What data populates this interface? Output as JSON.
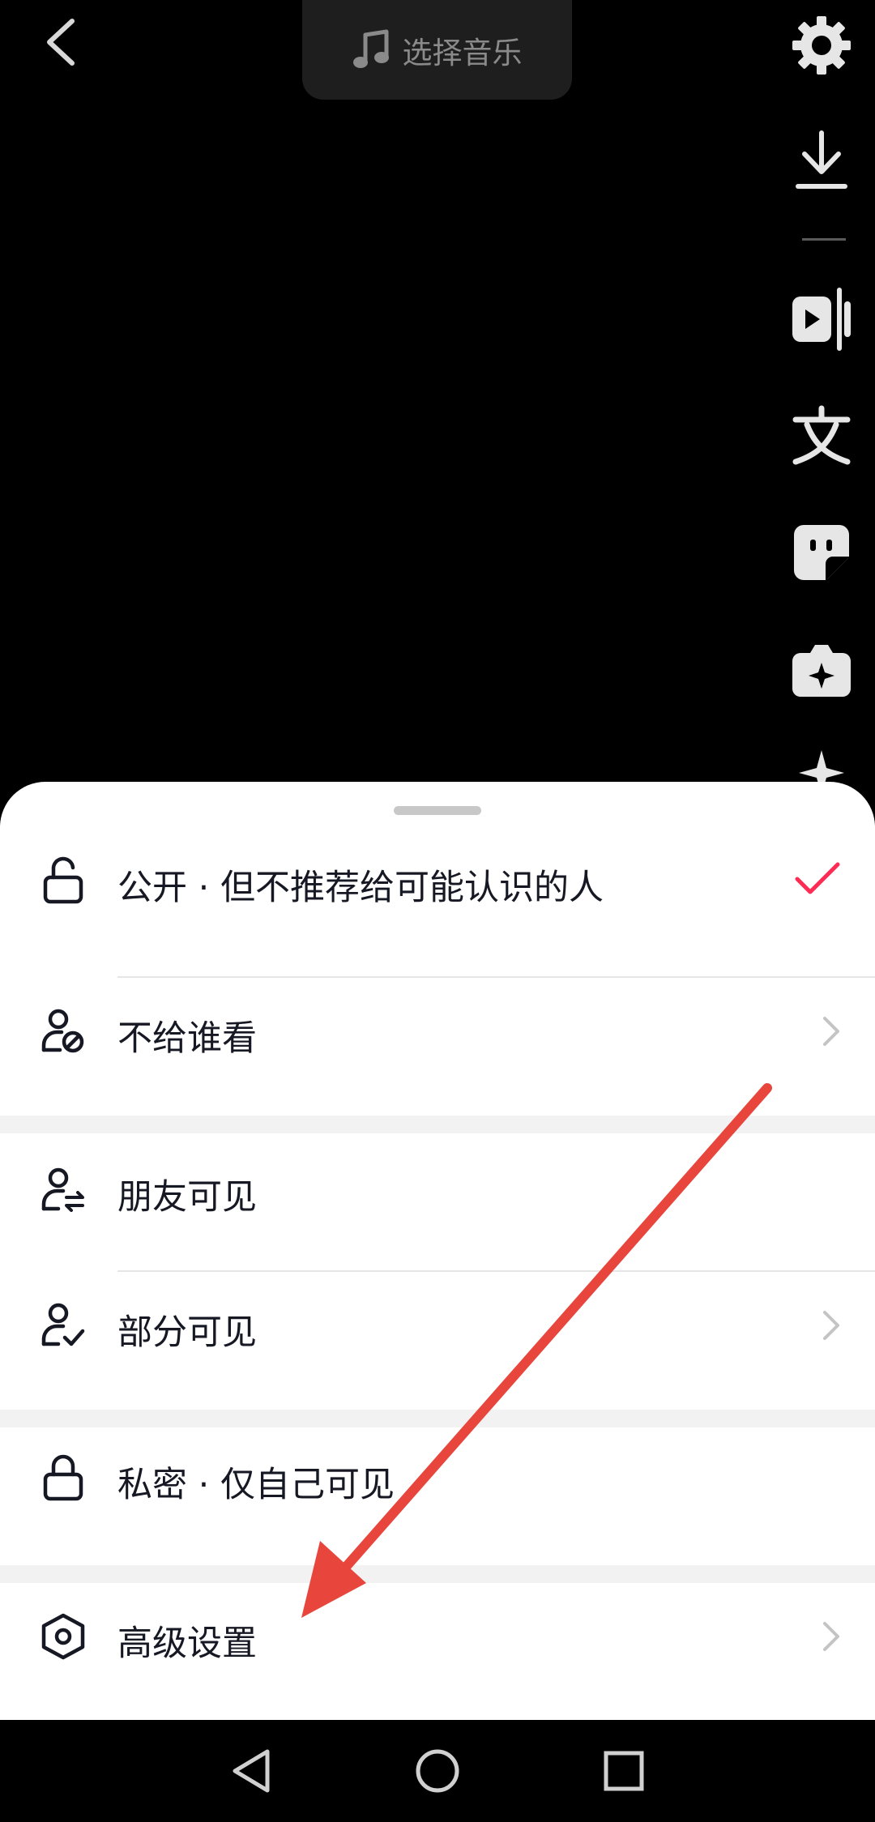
{
  "editor": {
    "music_label": "选择音乐"
  },
  "sheet": {
    "options": [
      {
        "label": "公开 · 但不推荐给可能认识的人",
        "icon": "unlock-icon",
        "selected": true
      },
      {
        "label": "不给谁看",
        "icon": "user-block-icon",
        "has_chevron": true
      },
      {
        "label": "朋友可见",
        "icon": "user-swap-icon"
      },
      {
        "label": "部分可见",
        "icon": "user-check-icon",
        "has_chevron": true
      },
      {
        "label": "私密 · 仅自己可见",
        "icon": "lock-icon"
      },
      {
        "label": "高级设置",
        "icon": "hexagon-settings-icon",
        "has_chevron": true
      }
    ]
  },
  "colors": {
    "accent": "#fe2c55",
    "annotation_arrow": "#e8453c",
    "sheet_bg": "#ffffff",
    "text": "#161823"
  }
}
